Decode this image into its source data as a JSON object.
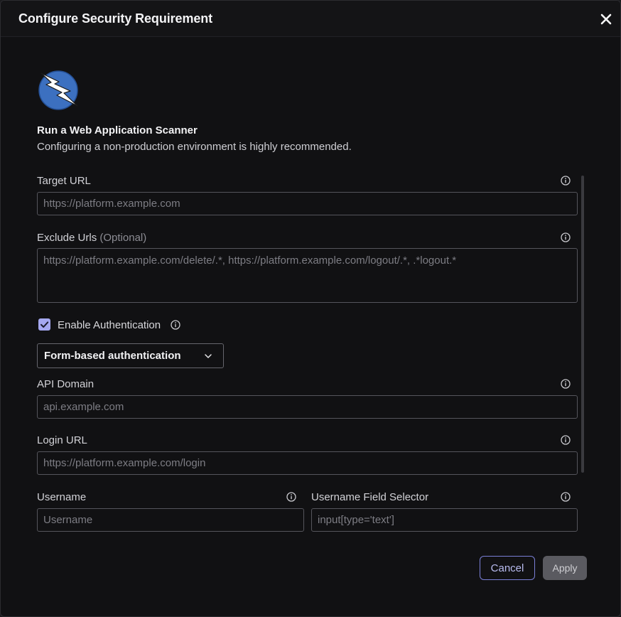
{
  "dialog": {
    "title": "Configure Security Requirement"
  },
  "intro": {
    "title": "Run a Web Application Scanner",
    "subtitle": "Configuring a non-production environment is highly recommended."
  },
  "fields": {
    "target_url": {
      "label": "Target URL",
      "placeholder": "https://platform.example.com"
    },
    "exclude_urls": {
      "label": "Exclude Urls",
      "optional": "(Optional)",
      "placeholder": "https://platform.example.com/delete/.*, https://platform.example.com/logout/.*, .*logout.*"
    },
    "enable_auth": {
      "label": "Enable Authentication",
      "checked": true
    },
    "auth_type": {
      "value": "Form-based authentication"
    },
    "api_domain": {
      "label": "API Domain",
      "placeholder": "api.example.com"
    },
    "login_url": {
      "label": "Login URL",
      "placeholder": "https://platform.example.com/login"
    },
    "username": {
      "label": "Username",
      "placeholder": "Username"
    },
    "username_selector": {
      "label": "Username Field Selector",
      "placeholder": "input[type='text']"
    }
  },
  "footer": {
    "cancel_label": "Cancel",
    "apply_label": "Apply"
  },
  "colors": {
    "accent": "#a5a8f0",
    "background": "#111113",
    "border": "#55555c"
  }
}
